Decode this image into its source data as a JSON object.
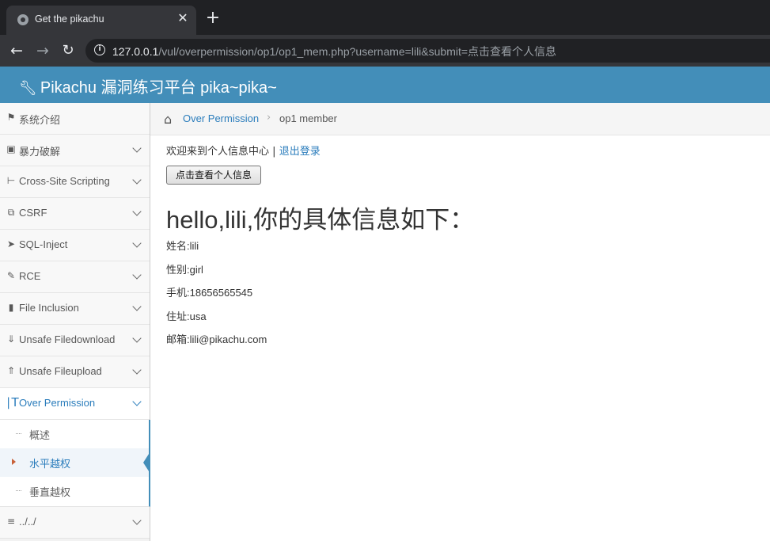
{
  "browser": {
    "tab_title": "Get the pikachu",
    "close_glyph": "✕",
    "newtab_glyph": "+",
    "url_host": "127.0.0.1",
    "url_path": "/vul/overpermission/op1/op1_mem.php?username=lili&submit=点击查看个人信息"
  },
  "header": {
    "brand_icon": "wrench-icon",
    "brand": "Pikachu 漏洞练习平台 pika~pika~",
    "color": "#438eb9"
  },
  "sidebar": {
    "items": [
      {
        "label": "系统介绍",
        "icon": "tags-icon"
      },
      {
        "label": "暴力破解",
        "icon": "lock-icon"
      },
      {
        "label": "Cross-Site Scripting",
        "icon": "sitemap-icon"
      },
      {
        "label": "CSRF",
        "icon": "external-link-icon"
      },
      {
        "label": "SQL-Inject",
        "icon": "plane-icon"
      },
      {
        "label": "RCE",
        "icon": "pencil-icon"
      },
      {
        "label": "File Inclusion",
        "icon": "file-icon"
      },
      {
        "label": "Unsafe Filedownload",
        "icon": "download-icon"
      },
      {
        "label": "Unsafe Fileupload",
        "icon": "upload-icon"
      },
      {
        "label": "Over Permission",
        "icon": "text-height-icon"
      },
      {
        "label": "../../",
        "icon": "align-left-icon"
      }
    ],
    "submenu": [
      {
        "label": "概述"
      },
      {
        "label": "水平越权"
      },
      {
        "label": "垂直越权"
      }
    ],
    "active_color": "#2b7dbc"
  },
  "breadcrumb": {
    "parent": "Over Permission",
    "separator": "›",
    "current": "op1 member"
  },
  "main": {
    "welcome": "欢迎来到个人信息中心",
    "divider": "|",
    "logout": "退出登录",
    "button_label": "点击查看个人信息",
    "greeting": "hello,lili,你的具体信息如下：",
    "info": [
      "姓名:lili",
      "性别:girl",
      "手机:18656565545",
      "住址:usa",
      "邮箱:lili@pikachu.com"
    ]
  }
}
